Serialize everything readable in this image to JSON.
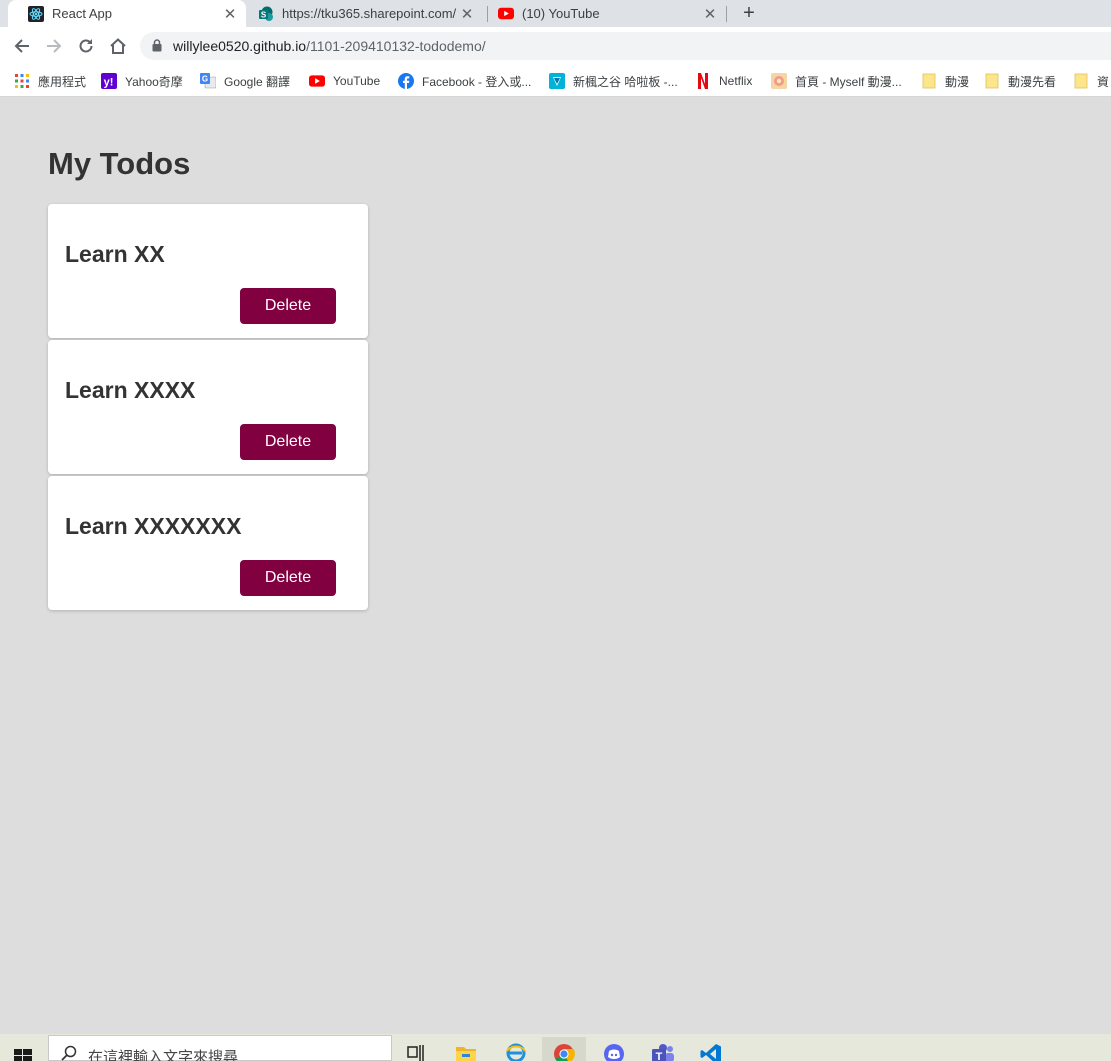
{
  "browser": {
    "tabs": [
      {
        "title": "React App",
        "active": true
      },
      {
        "title": "https://tku365.sharepoint.com/",
        "active": false
      },
      {
        "title": "(10) YouTube",
        "active": false
      }
    ],
    "close_glyph": "✕",
    "newtab_glyph": "+",
    "url_host": "willylee0520.github.io",
    "url_path": "/1101-209410132-tododemo/"
  },
  "bookmarks": [
    {
      "label": "應用程式",
      "icon": "apps-grid-icon"
    },
    {
      "label": "Yahoo奇摩",
      "icon": "yahoo-icon"
    },
    {
      "label": "Google 翻譯",
      "icon": "google-translate-icon"
    },
    {
      "label": "YouTube",
      "icon": "youtube-icon"
    },
    {
      "label": "Facebook - 登入或...",
      "icon": "facebook-icon"
    },
    {
      "label": "新楓之谷 哈啦板 -...",
      "icon": "bahamut-icon"
    },
    {
      "label": "Netflix",
      "icon": "netflix-icon"
    },
    {
      "label": "首頁 - Myself 動漫...",
      "icon": "myself-icon"
    },
    {
      "label": "動漫",
      "icon": "folder-icon"
    },
    {
      "label": "動漫先看",
      "icon": "folder-icon"
    },
    {
      "label": "資",
      "icon": "folder-icon"
    }
  ],
  "page": {
    "title": "My Todos",
    "todos": [
      {
        "text": "Learn XX",
        "button": "Delete"
      },
      {
        "text": "Learn XXXX",
        "button": "Delete"
      },
      {
        "text": "Learn XXXXXXX",
        "button": "Delete"
      }
    ]
  },
  "taskbar": {
    "search_placeholder": "在這裡輸入文字來搜尋",
    "apps": [
      "task-view-icon",
      "file-explorer-icon",
      "edge-icon",
      "chrome-icon",
      "discord-icon",
      "teams-icon",
      "vscode-icon"
    ]
  },
  "colors": {
    "page_background": "#dddddd",
    "delete_button": "#800040",
    "text": "#333333"
  }
}
